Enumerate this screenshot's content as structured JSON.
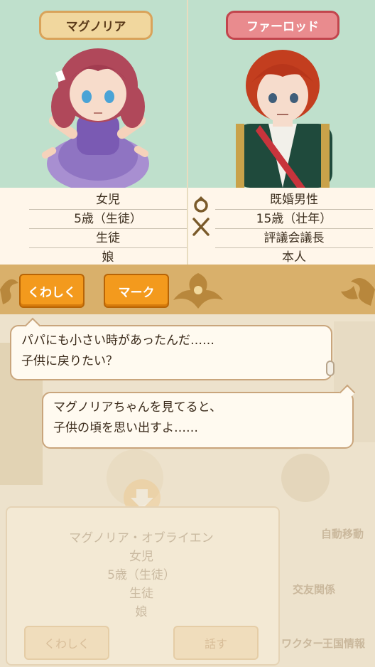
{
  "characters": {
    "left": {
      "name": "マグノリア",
      "info": [
        "女児",
        "5歳（生徒）",
        "生徒",
        "娘"
      ]
    },
    "right": {
      "name": "ファーロッド",
      "info": [
        "既婚男性",
        "15歳（壮年）",
        "評議会議長",
        "本人"
      ]
    }
  },
  "buttons": {
    "detail": "くわしく",
    "mark": "マーク"
  },
  "dialogue": {
    "line1a": "パパにも小さい時があったんだ……",
    "line1b": "子供に戻りたい？",
    "line2a": "マグノリアちゃんを見てると、",
    "line2b": "子供の頃を思い出すよ……"
  },
  "background_panel": {
    "name": "マグノリア・オブライエン",
    "info": [
      "女児",
      "5歳（生徒）",
      "生徒",
      "娘"
    ],
    "detail_button": "くわしく",
    "talk_button": "話す",
    "menu": [
      "自動移動",
      "交友関係",
      "王国情報",
      "ワクター"
    ]
  },
  "colors": {
    "portrait_bg": "#bfe0cc",
    "button_orange": "#f39a1d",
    "name_tag_female": "#f1d79e",
    "name_tag_male": "#e98b8e"
  }
}
